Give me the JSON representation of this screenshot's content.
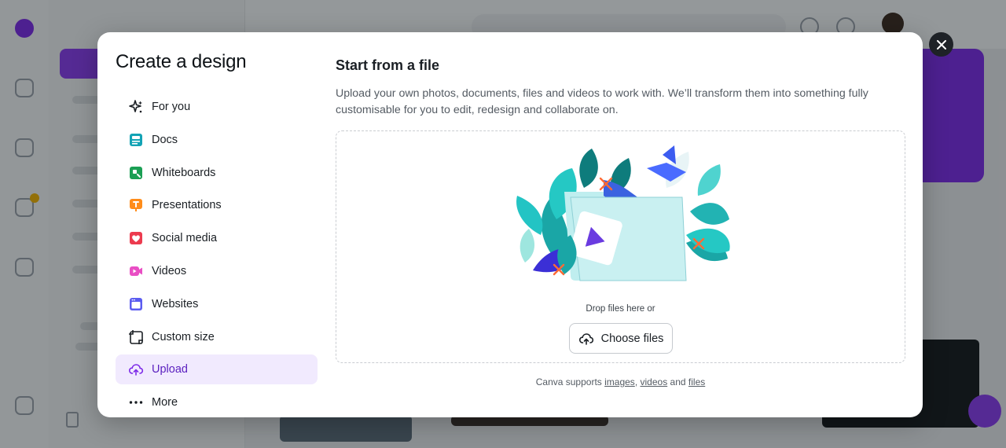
{
  "modal": {
    "title": "Create a design",
    "nav": [
      {
        "label": "For you",
        "icon": "sparkle-icon",
        "color": "#1a1f24"
      },
      {
        "label": "Docs",
        "icon": "docs-icon",
        "color": "#13a3b5"
      },
      {
        "label": "Whiteboards",
        "icon": "whiteboard-icon",
        "color": "#1b9f54"
      },
      {
        "label": "Presentations",
        "icon": "presentation-icon",
        "color": "#ff8c1a"
      },
      {
        "label": "Social media",
        "icon": "heart-icon",
        "color": "#ec3b4f"
      },
      {
        "label": "Videos",
        "icon": "video-icon",
        "color": "#e94ec4"
      },
      {
        "label": "Websites",
        "icon": "website-icon",
        "color": "#5b5cf0"
      },
      {
        "label": "Custom size",
        "icon": "custom-size-icon",
        "color": "#1a1f24"
      },
      {
        "label": "Upload",
        "icon": "cloud-upload-icon",
        "color": "#7d2ae8",
        "active": true
      },
      {
        "label": "More",
        "icon": "more-icon",
        "color": "#1a1f24"
      }
    ],
    "upload": {
      "section_title": "Start from a file",
      "description": "Upload your own photos, documents, files and videos to work with. We’ll transform them into something fully customisable for you to edit, redesign and collaborate on.",
      "drop_text": "Drop files here or",
      "choose_button": "Choose files",
      "supports_prefix": "Canva supports",
      "link_images": "images",
      "separator": ",",
      "link_videos": "videos",
      "conjunction": "and",
      "link_files": "files"
    }
  },
  "colors": {
    "accent": "#7d2ae8",
    "active_bg": "#f1eafe"
  }
}
